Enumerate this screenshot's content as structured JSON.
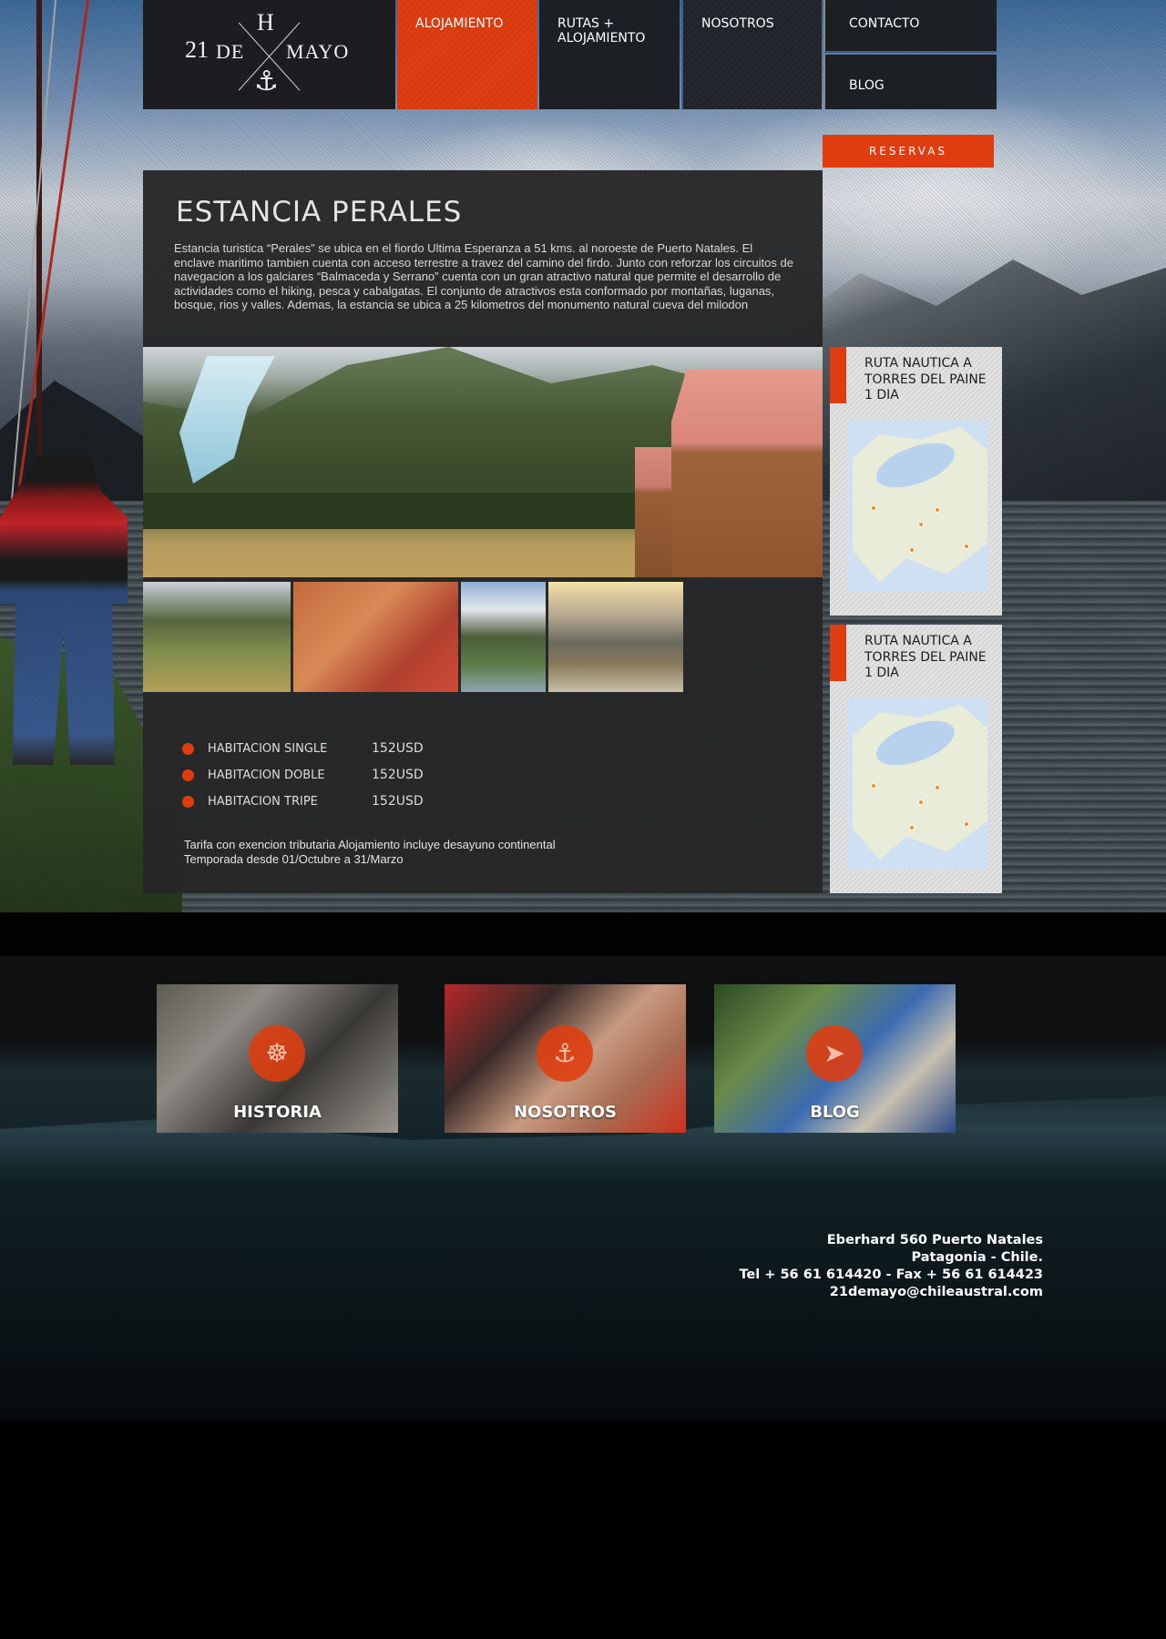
{
  "nav": {
    "logo": {
      "h": "H",
      "number": "21",
      "de": "DE",
      "mayo": "MAYO",
      "anchor_icon": "anchor-icon"
    },
    "items": [
      {
        "label": "ALOJAMIENTO",
        "active": true
      },
      {
        "label": "RUTAS + ALOJAMIENTO"
      },
      {
        "label": "NOSOTROS"
      },
      {
        "label": "CONTACTO"
      },
      {
        "label": "BLOG"
      }
    ],
    "reservas": "RESERVAS"
  },
  "main": {
    "title": "ESTANCIA PERALES",
    "description": "Estancia turistica “Perales” se ubica en el fiordo Ultima Esperanza a 51 kms. al noroeste de Puerto Natales. El enclave maritimo tambien cuenta con acceso terrestre a travez del camino del firdo. Junto con reforzar los circuitos de navegacion a los galciares “Balmaceda y Serrano” cuenta con un gran atractivo natural que permite el desarrollo de actividades como el hiking, pesca y cabalgatas. El conjunto de atractivos esta conformado por montañas, luganas, bosque, rios y valles. Ademas, la estancia se ubica a 25 kilometros del monumento natural cueva del milodon",
    "prices": [
      {
        "name": "HABITACION SINGLE",
        "value": "152USD"
      },
      {
        "name": "HABITACION DOBLE",
        "value": "152USD"
      },
      {
        "name": "HABITACION TRIPE",
        "value": "152USD"
      }
    ],
    "tarifa_line1": "Tarifa con exencion tributaria Alojamiento incluye desayuno continental",
    "tarifa_line2": "Temporada desde 01/Octubre a 31/Marzo"
  },
  "sidebar": {
    "routes": [
      {
        "title": "RUTA NAUTICA A TORRES DEL PAINE 1 DIA"
      },
      {
        "title": "RUTA NAUTICA A TORRES DEL PAINE 1 DIA"
      }
    ]
  },
  "footer": {
    "cards": [
      {
        "title": "HISTORIA",
        "icon": "ship-wheel-icon"
      },
      {
        "title": "NOSOTROS",
        "icon": "anchor-icon"
      },
      {
        "title": "BLOG",
        "icon": "compass-icon"
      }
    ],
    "address": {
      "line1": "Eberhard 560 Puerto Natales",
      "line2": "Patagonia - Chile.",
      "line3": "Tel + 56 61 614420 - Fax + 56 61 614423",
      "line4": "21demayo@chileaustral.com"
    }
  },
  "colors": {
    "accent": "#e03c0f",
    "panel": "#262628",
    "nav": "#1c1f24"
  }
}
